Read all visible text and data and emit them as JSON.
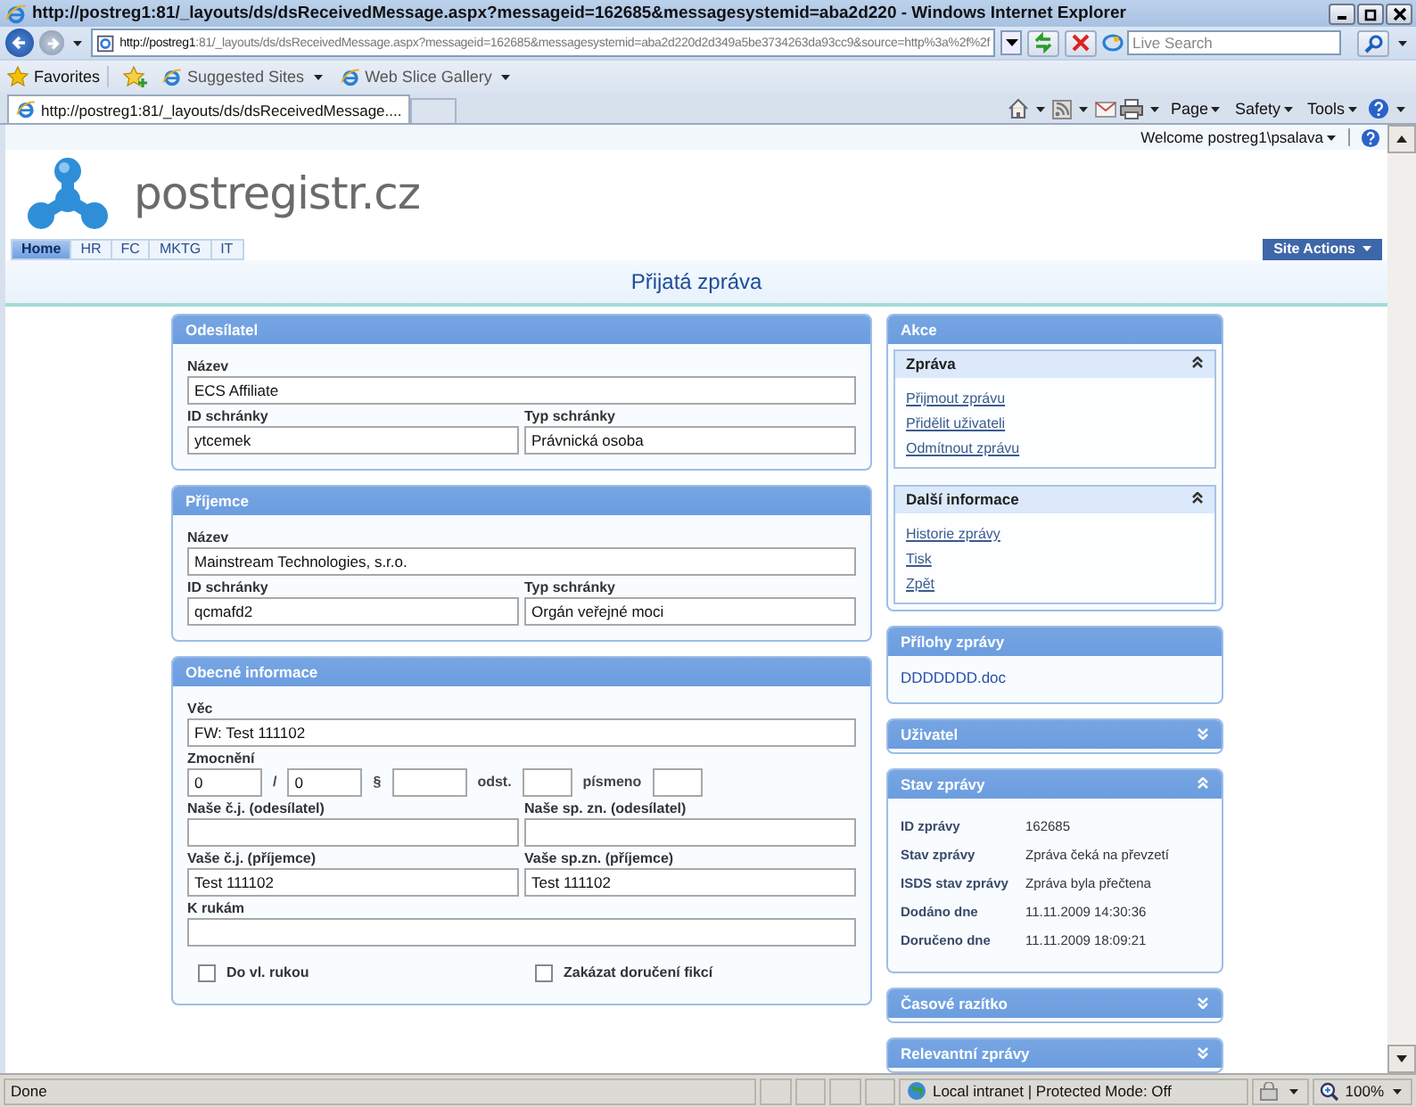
{
  "browser": {
    "title": "http://postreg1:81/_layouts/ds/dsReceivedMessage.aspx?messageid=162685&messagesystemid=aba2d220 - Windows Internet Explorer",
    "address_host": "http://postreg1",
    "address_rest": ":81/_layouts/ds/dsReceivedMessage.aspx?messageid=162685&messagesystemid=aba2d220d2d349a5be3734263da93cc9&source=http%3a%2f%2f",
    "search": {
      "placeholder": "Live Search"
    },
    "favorites": "Favorites",
    "links": [
      "Suggested Sites",
      "Web Slice Gallery"
    ],
    "tab": "http://postreg1:81/_layouts/ds/dsReceivedMessage....",
    "commands": [
      "Page",
      "Safety",
      "Tools"
    ]
  },
  "site": {
    "welcome": "Welcome postreg1\\psalava",
    "logo": "postregistr.cz",
    "nav": [
      {
        "label": "Home",
        "selected": true
      },
      {
        "label": "HR",
        "selected": false
      },
      {
        "label": "FC",
        "selected": false
      },
      {
        "label": "MKTG",
        "selected": false
      },
      {
        "label": "IT",
        "selected": false
      }
    ],
    "site_actions": "Site Actions",
    "page_title": "Přijatá zpráva"
  },
  "sections": [
    {
      "title": "Odesílatel",
      "rows": [
        [
          {
            "kind": "text",
            "label": "Název",
            "value": "ECS Affiliate"
          }
        ],
        [
          {
            "kind": "text",
            "label": "ID schránky",
            "value": "ytcemek"
          },
          {
            "kind": "text",
            "label": "Typ schránky",
            "value": "Právnická osoba"
          }
        ]
      ]
    },
    {
      "title": "Příjemce",
      "rows": [
        [
          {
            "kind": "text",
            "label": "Název",
            "value": "Mainstream Technologies, s.r.o."
          }
        ],
        [
          {
            "kind": "text",
            "label": "ID schránky",
            "value": "qcmafd2"
          },
          {
            "kind": "text",
            "label": "Typ schránky",
            "value": "Orgán veřejné moci"
          }
        ]
      ]
    },
    {
      "title": "Obecné informace",
      "rows": [
        [
          {
            "kind": "text",
            "label": "Věc",
            "value": "FW: Test 111102"
          }
        ],
        [
          {
            "kind": "parts",
            "label": "Zmocnění",
            "parts": [
              {
                "kind": "input",
                "value": "0"
              },
              {
                "kind": "sep",
                "text": "/"
              },
              {
                "kind": "input",
                "value": "0"
              },
              {
                "kind": "sep",
                "text": "§"
              },
              {
                "kind": "input"
              },
              {
                "kind": "sep",
                "text": "odst."
              },
              {
                "kind": "input"
              },
              {
                "kind": "sep",
                "text": "písmeno"
              },
              {
                "kind": "input"
              }
            ]
          }
        ],
        [
          {
            "kind": "text",
            "label": "Naše č.j. (odesílatel)"
          },
          {
            "kind": "text",
            "label": "Naše sp. zn. (odesílatel)"
          }
        ],
        [
          {
            "kind": "text",
            "label": "Vaše č.j. (příjemce)",
            "value": "Test 111102"
          },
          {
            "kind": "text",
            "label": "Vaše sp.zn. (příjemce)",
            "value": "Test 111102"
          }
        ],
        [
          {
            "kind": "text",
            "label": "K rukám"
          }
        ],
        [
          {
            "kind": "checkbox",
            "label": "Do vl. rukou",
            "checked": false
          },
          {
            "kind": "checkbox",
            "label": "Zakázat doručení fikcí",
            "checked": false
          }
        ]
      ]
    }
  ],
  "panels": [
    {
      "kind": "actions",
      "title": "Akce",
      "groups": [
        {
          "title": "Zpráva",
          "expanded": true,
          "links": [
            "Přijmout zprávu",
            "Přidělit uživateli",
            "Odmítnout zprávu"
          ]
        },
        {
          "title": "Další informace",
          "expanded": true,
          "links": [
            "Historie zprávy",
            "Tisk",
            "Zpět"
          ]
        }
      ]
    },
    {
      "kind": "attachments",
      "title": "Přílohy zprávy",
      "items": [
        "DDDDDDD.doc"
      ]
    },
    {
      "kind": "details",
      "title": "Uživatel",
      "expanded": false
    },
    {
      "kind": "details",
      "title": "Stav zprávy",
      "expanded": true,
      "rows": [
        {
          "label": "ID zprávy",
          "value": "162685"
        },
        {
          "label": "Stav zprávy",
          "value": "Zpráva čeká na převzetí"
        },
        {
          "label": "ISDS stav zprávy",
          "value": "Zpráva byla přečtena"
        },
        {
          "label": "Dodáno dne",
          "value": "11.11.2009 14:30:36"
        },
        {
          "label": "Doručeno dne",
          "value": "11.11.2009 18:09:21"
        }
      ]
    },
    {
      "kind": "details",
      "title": "Časové razítko",
      "expanded": false
    },
    {
      "kind": "details",
      "title": "Relevantní zprávy",
      "expanded": false
    }
  ],
  "status_bar": {
    "text": "Done",
    "zone": "Local intranet | Protected Mode: Off",
    "zoom": "100%"
  }
}
